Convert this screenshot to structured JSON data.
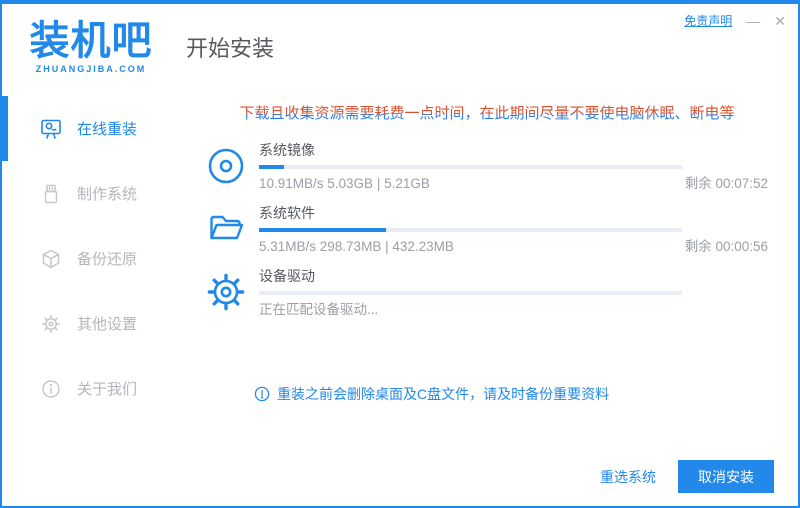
{
  "colors": {
    "accent": "#2288ea",
    "warning_top": "#d8512e",
    "warning_bottom": "#2b7ce9",
    "progress_track": "#e7edf5",
    "inactive_gray": "#b3b6ba"
  },
  "titlebar": {
    "disclaimer_label": "免责声明",
    "minimize_glyph": "—",
    "close_glyph": "✕"
  },
  "header": {
    "logo_text": "装机吧",
    "logo_tagline": "ZHUANGJIBA.COM",
    "page_title": "开始安装"
  },
  "sidebar": {
    "items": [
      {
        "label": "在线重装",
        "icon": "monitor-icon",
        "active": true
      },
      {
        "label": "制作系统",
        "icon": "usb-icon",
        "active": false
      },
      {
        "label": "备份还原",
        "icon": "backup-icon",
        "active": false
      },
      {
        "label": "其他设置",
        "icon": "settings-icon",
        "active": false
      },
      {
        "label": "关于我们",
        "icon": "about-icon",
        "active": false
      }
    ]
  },
  "main": {
    "warning": "下载且收集资源需要耗费一点时间，在此期间尽量不要使电脑休眠、断电等",
    "tasks": [
      {
        "icon": "disc-icon",
        "title": "系统镜像",
        "progress_percent": 6,
        "stats": "10.91MB/s 5.03GB | 5.21GB",
        "remaining": "剩余 00:07:52"
      },
      {
        "icon": "folder-icon",
        "title": "系统软件",
        "progress_percent": 30,
        "stats": "5.31MB/s 298.73MB | 432.23MB",
        "remaining": "剩余 00:00:56"
      },
      {
        "icon": "gear-icon",
        "title": "设备驱动",
        "progress_percent": 0,
        "stats": "正在匹配设备驱动...",
        "remaining": ""
      }
    ],
    "note": "重装之前会删除桌面及C盘文件，请及时备份重要资料"
  },
  "footer": {
    "reselect_label": "重选系统",
    "cancel_label": "取消安装"
  }
}
